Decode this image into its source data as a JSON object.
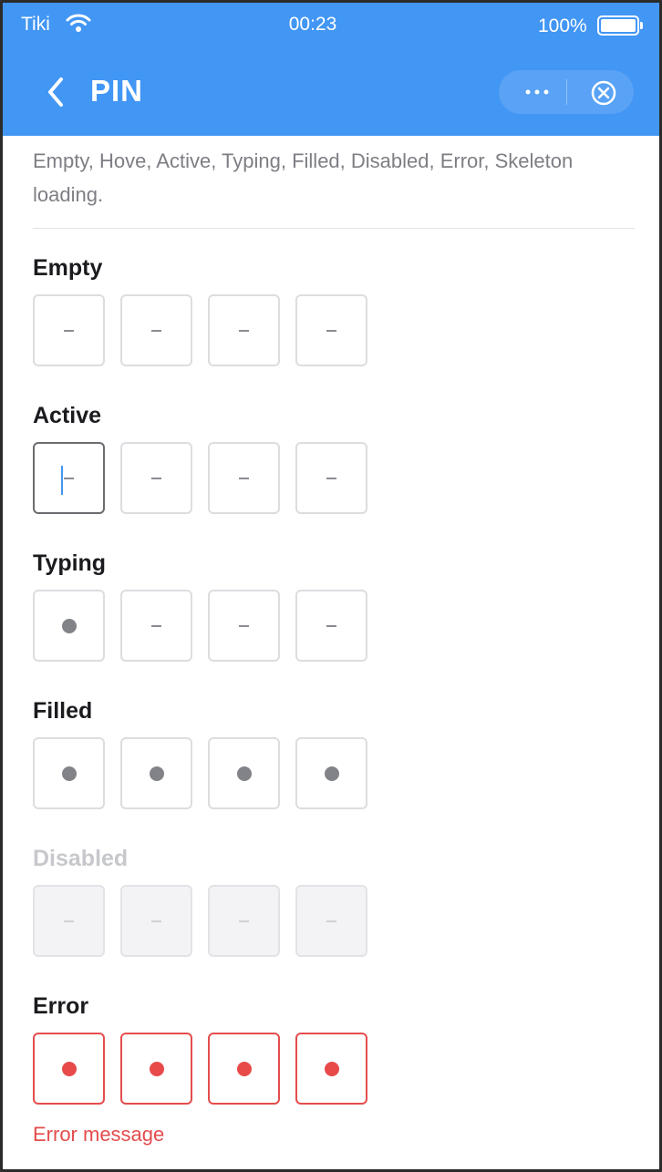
{
  "status": {
    "carrier": "Tiki",
    "time": "00:23",
    "battery": "100%"
  },
  "nav": {
    "title": "PIN"
  },
  "description": "Empty, Hove, Active, Typing, Filled, Disabled, Error, Skeleton loading.",
  "sections": {
    "empty": {
      "label": "Empty",
      "cells": [
        "-",
        "-",
        "-",
        "-"
      ]
    },
    "active": {
      "label": "Active",
      "cells": [
        "-",
        "-",
        "-",
        "-"
      ]
    },
    "typing": {
      "label": "Typing",
      "cells": [
        "●",
        "-",
        "-",
        "-"
      ]
    },
    "filled": {
      "label": "Filled",
      "cells": [
        "●",
        "●",
        "●",
        "●"
      ]
    },
    "disabled": {
      "label": "Disabled",
      "cells": [
        "-",
        "-",
        "-",
        "-"
      ]
    },
    "error": {
      "label": "Error",
      "cells": [
        "●",
        "●",
        "●",
        "●"
      ],
      "message": "Error message"
    }
  },
  "colors": {
    "accent": "#4296f4",
    "error": "#e84a4a",
    "dot": "#828388"
  },
  "icons": {
    "back": "chevron-left-icon",
    "more": "more-dots-icon",
    "close": "close-circle-icon",
    "wifi": "wifi-icon",
    "battery": "battery-icon"
  }
}
